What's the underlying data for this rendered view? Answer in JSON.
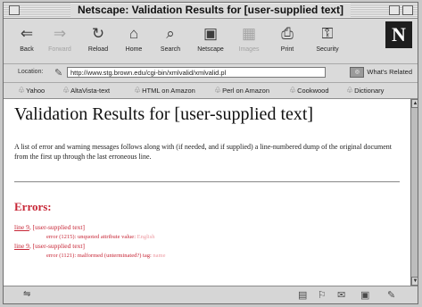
{
  "window": {
    "title": "Netscape: Validation Results for [user-supplied text]"
  },
  "toolbar": {
    "buttons": [
      {
        "label": "Back",
        "icon": "back-arrow-icon",
        "glyph": "⇐"
      },
      {
        "label": "Forward",
        "icon": "forward-arrow-icon",
        "glyph": "⇒"
      },
      {
        "label": "Reload",
        "icon": "reload-icon",
        "glyph": "↻"
      },
      {
        "label": "Home",
        "icon": "home-icon",
        "glyph": "⌂"
      },
      {
        "label": "Search",
        "icon": "search-icon",
        "glyph": "⌕"
      },
      {
        "label": "Netscape",
        "icon": "netscape-icon",
        "glyph": "▣"
      },
      {
        "label": "Images",
        "icon": "images-icon",
        "glyph": "▦"
      },
      {
        "label": "Print",
        "icon": "print-icon",
        "glyph": "⎙"
      },
      {
        "label": "Security",
        "icon": "lock-icon",
        "glyph": "⚿"
      }
    ],
    "logo": "N"
  },
  "location": {
    "label": "Location:",
    "url": "http://www.stg.brown.edu/cgi-bin/xmlvalid/xmlvalid.pl",
    "related": "What's Related"
  },
  "bookmarks": [
    "Yahoo",
    "AltaVista-text",
    "HTML on Amazon",
    "Perl on Amazon",
    "Cookwood",
    "Dictionary"
  ],
  "content": {
    "heading": "Validation Results for [user-supplied text]",
    "intro": "A list of error and warning messages follows along with (if needed, and if supplied) a line-numbered dump of the original document from the first up through the last erroneous line.",
    "errors_heading": "Errors:",
    "errors": [
      {
        "line_link": "line 9",
        "source": ", [user-supplied text]",
        "detail": "error (1215): unquoted attribute value: ",
        "value": "English"
      },
      {
        "line_link": "line 9",
        "source": ", [user-supplied text]",
        "detail": "error (1121): malformed (unterminated?) tag: ",
        "value": "name"
      }
    ]
  },
  "status": {
    "left_icon": "connection-icon",
    "right_icons": [
      "component-icon",
      "component-icon",
      "mail-icon",
      "composer-icon",
      "edit-icon"
    ]
  }
}
